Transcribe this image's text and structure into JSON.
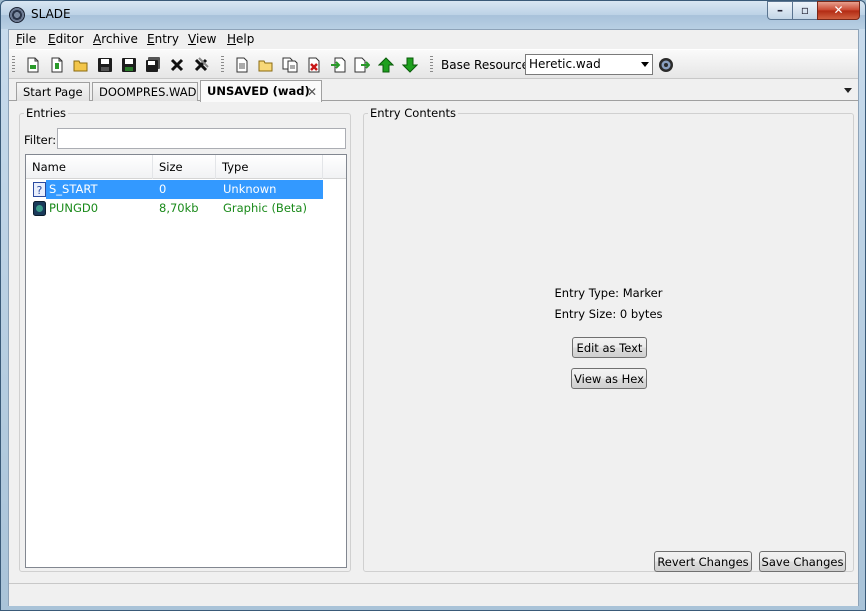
{
  "window": {
    "title": "SLADE"
  },
  "menu": {
    "items": [
      {
        "label": "File",
        "mnemonic": "F",
        "rest": "ile"
      },
      {
        "label": "Editor",
        "mnemonic": "E",
        "rest": "ditor"
      },
      {
        "label": "Archive",
        "mnemonic": "A",
        "rest": "rchive"
      },
      {
        "label": "Entry",
        "mnemonic": "E",
        "rest": "ntry"
      },
      {
        "label": "View",
        "mnemonic": "V",
        "rest": "iew"
      },
      {
        "label": "Help",
        "mnemonic": "H",
        "rest": "elp"
      }
    ]
  },
  "toolbar": {
    "base_resource_label": "Base Resource:",
    "base_resource_value": "Heretic.wad"
  },
  "tabs": [
    {
      "label": "Start Page",
      "active": false
    },
    {
      "label": "DOOMPRES.WAD",
      "active": false
    },
    {
      "label": "UNSAVED (wad)",
      "active": true
    }
  ],
  "entries_panel": {
    "title": "Entries",
    "filter_label": "Filter:",
    "filter_value": "",
    "columns": [
      "Name",
      "Size",
      "Type"
    ],
    "rows": [
      {
        "name": "S_START",
        "size": "0",
        "type": "Unknown",
        "icon": "marker-icon",
        "selected": true
      },
      {
        "name": "PUNGD0",
        "size": "8,70kb",
        "type": "Graphic (Beta)",
        "icon": "graphic-icon",
        "selected": false
      }
    ]
  },
  "contents_panel": {
    "title": "Entry Contents",
    "entry_type": "Entry Type: Marker",
    "entry_size": "Entry Size: 0 bytes",
    "edit_as_text": "Edit as Text",
    "view_as_hex": "View as Hex",
    "revert_changes": "Revert Changes",
    "save_changes": "Save Changes"
  },
  "colors": {
    "selection": "#3399ff",
    "graphic_text": "#1a8a1a",
    "close_button": "#c8442c"
  }
}
